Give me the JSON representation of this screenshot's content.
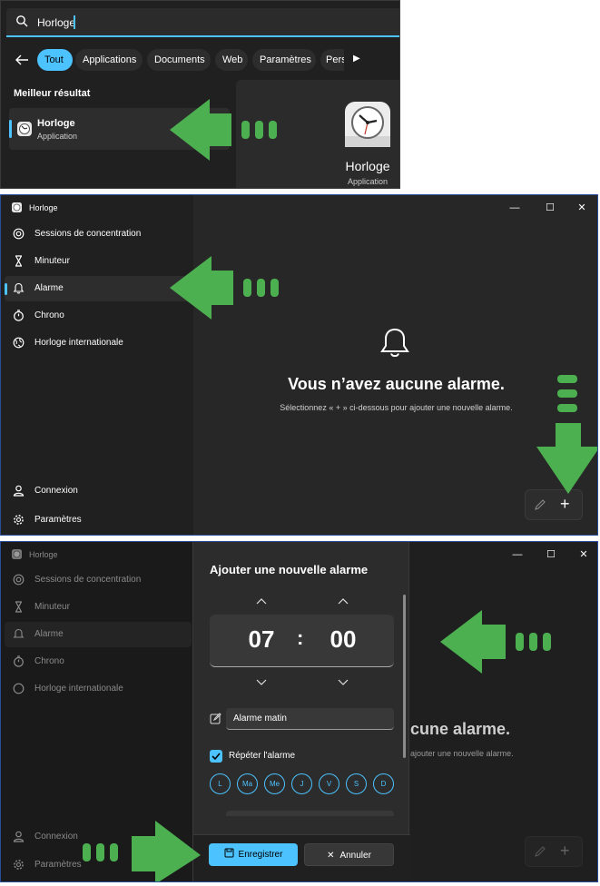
{
  "colors": {
    "accent": "#4cc2ff",
    "arrow": "#4caf50"
  },
  "search": {
    "query": "Horloge",
    "chips": [
      "Tout",
      "Applications",
      "Documents",
      "Web",
      "Paramètres",
      "Pers"
    ],
    "best_label": "Meilleur résultat",
    "result": {
      "name": "Horloge",
      "type": "Application"
    },
    "preview": {
      "name": "Horloge",
      "type": "Application"
    }
  },
  "clock": {
    "app_title": "Horloge",
    "nav": [
      {
        "label": "Sessions de concentration",
        "icon": "focus-icon"
      },
      {
        "label": "Minuteur",
        "icon": "hourglass-icon"
      },
      {
        "label": "Alarme",
        "icon": "bell-icon"
      },
      {
        "label": "Chrono",
        "icon": "stopwatch-icon"
      },
      {
        "label": "Horloge internationale",
        "icon": "globe-icon"
      }
    ],
    "bottom_nav": [
      {
        "label": "Connexion",
        "icon": "user-icon"
      },
      {
        "label": "Paramètres",
        "icon": "gear-icon"
      }
    ],
    "empty_title": "Vous n’avez aucune alarme.",
    "empty_sub": "Sélectionnez « + » ci-dessous pour ajouter une nouvelle alarme.",
    "add_glyph": "+"
  },
  "dialog": {
    "title": "Ajouter une nouvelle alarme",
    "hour": "07",
    "separator": ":",
    "minute": "00",
    "alarm_name": "Alarme matin",
    "repeat_label": "Répéter l'alarme",
    "days": [
      "L",
      "Ma",
      "Me",
      "J",
      "V",
      "S",
      "D"
    ],
    "save_label": "Enregistrer",
    "cancel_label": "Annuler",
    "behind_title": "cune alarme.",
    "behind_sub": "ajouter une nouvelle alarme."
  }
}
